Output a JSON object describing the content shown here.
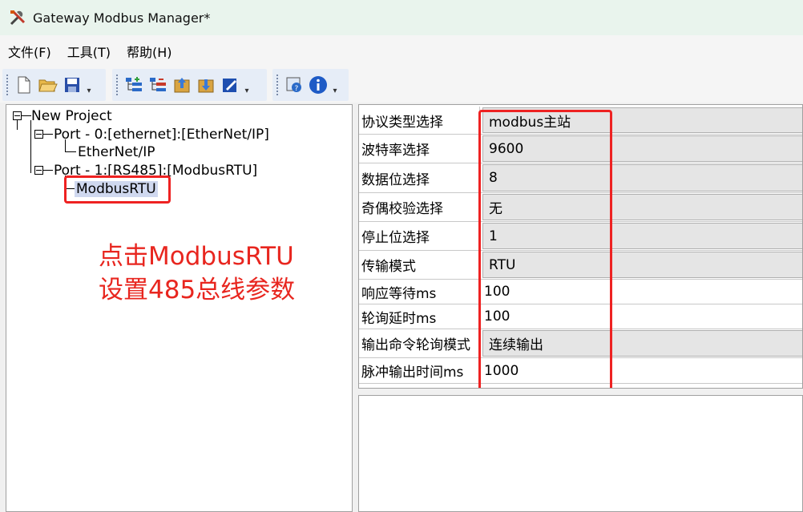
{
  "window": {
    "title": "Gateway Modbus Manager*"
  },
  "menu": {
    "items": [
      "文件(F)",
      "工具(T)",
      "帮助(H)"
    ]
  },
  "toolbar": {
    "icons": [
      "new-file-icon",
      "open-folder-icon",
      "save-icon",
      "add-port-icon",
      "remove-port-icon",
      "upload-icon",
      "download-icon",
      "edit-icon",
      "help-icon",
      "info-icon"
    ]
  },
  "tree": {
    "root": "New Project",
    "port0": "Port - 0:[ethernet]:[EtherNet/IP]",
    "port0_child": "EtherNet/IP",
    "port1": "Port - 1:[RS485]:[ModbusRTU]",
    "port1_child": "ModbusRTU"
  },
  "annotation": {
    "line1": "点击ModbusRTU",
    "line2": "设置485总线参数",
    "color": "#e8261f"
  },
  "properties": [
    {
      "key": "协议类型选择",
      "value": "modbus主站"
    },
    {
      "key": "波特率选择",
      "value": "9600"
    },
    {
      "key": "数据位选择",
      "value": "8"
    },
    {
      "key": "奇偶校验选择",
      "value": "无"
    },
    {
      "key": "停止位选择",
      "value": "1"
    },
    {
      "key": "传输模式",
      "value": "RTU"
    },
    {
      "key": "响应等待ms",
      "value": "100"
    },
    {
      "key": "轮询延时ms",
      "value": "100"
    },
    {
      "key": "输出命令轮询模式",
      "value": "连续输出"
    },
    {
      "key": "脉冲输出时间ms",
      "value": "1000"
    }
  ]
}
